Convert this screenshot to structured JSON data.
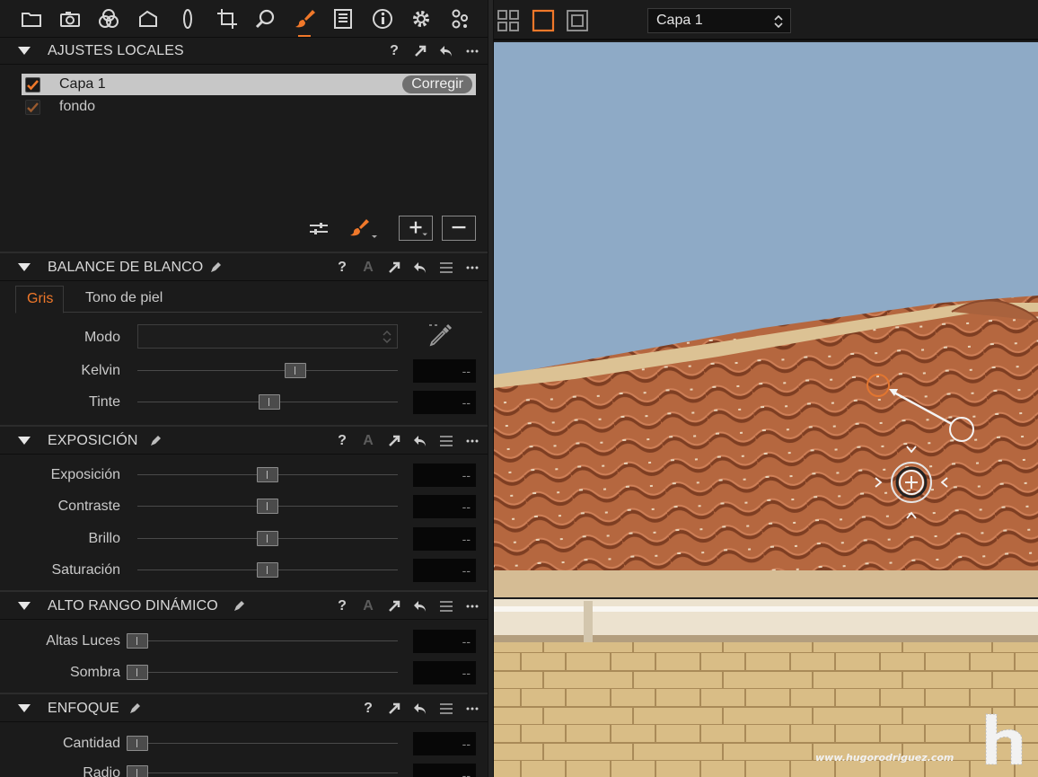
{
  "tool_tabs": [
    {
      "name": "folder-icon"
    },
    {
      "name": "camera-icon"
    },
    {
      "name": "color-circles-icon"
    },
    {
      "name": "lens-shape-icon"
    },
    {
      "name": "lens-icon"
    },
    {
      "name": "crop-icon"
    },
    {
      "name": "magnifier-icon"
    },
    {
      "name": "brush-icon",
      "active": true
    },
    {
      "name": "metadata-list-icon"
    },
    {
      "name": "info-icon"
    },
    {
      "name": "gear-icon"
    },
    {
      "name": "adjustments-icon"
    }
  ],
  "local_adjustments": {
    "title": "AJUSTES LOCALES",
    "layers": [
      {
        "name": "Capa 1",
        "checked": true,
        "selected": true
      },
      {
        "name": "fondo",
        "checked": true,
        "selected": false
      }
    ],
    "corregir_label": "Corregir",
    "add_label": "+",
    "remove_label": "−"
  },
  "white_balance": {
    "title": "BALANCE DE BLANCO",
    "tabs": [
      {
        "label": "Gris",
        "active": true
      },
      {
        "label": "Tono de piel",
        "active": false
      }
    ],
    "mode_label": "Modo",
    "mode_value": "",
    "rows": [
      {
        "label": "Kelvin",
        "value": "--",
        "level": 0.6
      },
      {
        "label": "Tinte",
        "value": "--",
        "level": 0.5
      }
    ]
  },
  "exposure": {
    "title": "EXPOSICIÓN",
    "rows": [
      {
        "label": "Exposición",
        "value": "--",
        "level": 0.5
      },
      {
        "label": "Contraste",
        "value": "--",
        "level": 0.5
      },
      {
        "label": "Brillo",
        "value": "--",
        "level": 0.5
      },
      {
        "label": "Saturación",
        "value": "--",
        "level": 0.5
      }
    ]
  },
  "hdr": {
    "title": "ALTO RANGO DINÁMICO",
    "rows": [
      {
        "label": "Altas Luces",
        "value": "--",
        "level": 0.0
      },
      {
        "label": "Sombra",
        "value": "--",
        "level": 0.0
      }
    ]
  },
  "sharpening": {
    "title": "ENFOQUE",
    "rows": [
      {
        "label": "Cantidad",
        "value": "--",
        "level": 0.0
      },
      {
        "label": "Radio",
        "value": "--",
        "level": 0.0
      }
    ]
  },
  "header_icons": {
    "help": "?",
    "auto": "A"
  },
  "viewer": {
    "layer_select": "Capa 1",
    "watermark": "www.hugorodriguez.com"
  },
  "colors": {
    "accent": "#f0782a",
    "sky": "#8ea9c6",
    "roof": "#b86a45",
    "wall": "#d8bd88"
  }
}
